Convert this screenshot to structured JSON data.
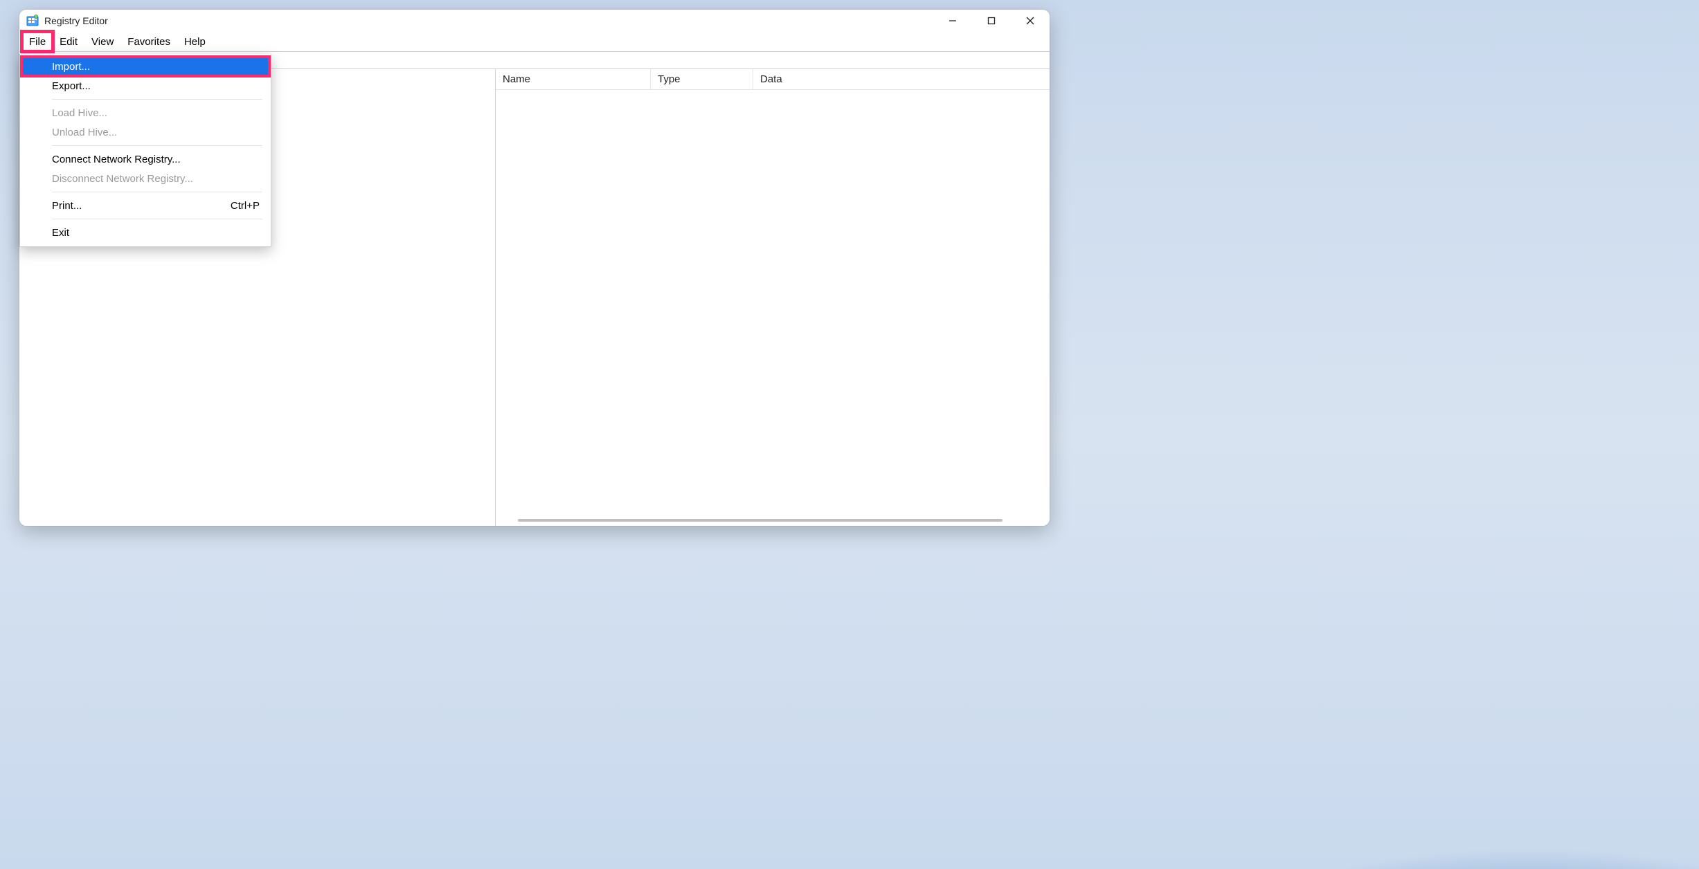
{
  "window": {
    "title": "Registry Editor"
  },
  "menubar": {
    "items": [
      "File",
      "Edit",
      "View",
      "Favorites",
      "Help"
    ],
    "active_index": 0
  },
  "file_menu": {
    "import": "Import...",
    "export": "Export...",
    "load_hive": "Load Hive...",
    "unload_hive": "Unload Hive...",
    "connect_net": "Connect Network Registry...",
    "disconnect_net": "Disconnect Network Registry...",
    "print": "Print...",
    "print_shortcut": "Ctrl+P",
    "exit": "Exit",
    "highlighted": "import"
  },
  "list_columns": {
    "name": "Name",
    "type": "Type",
    "data": "Data"
  },
  "annotation": {
    "highlight_color": "#ff2a6d",
    "selection_color": "#1a73e8"
  }
}
